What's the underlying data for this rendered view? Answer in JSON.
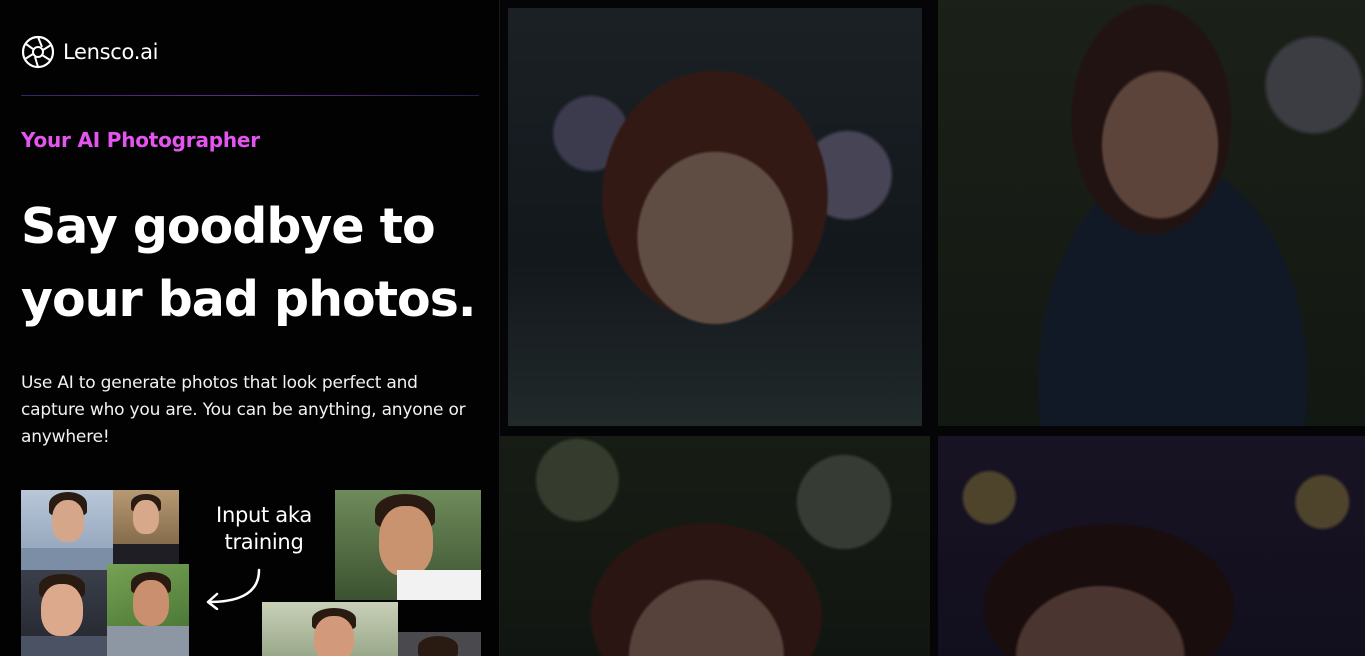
{
  "brand": {
    "name": "Lensco.ai",
    "logo_icon": "aperture-icon"
  },
  "hero": {
    "tagline": "Your AI Photographer",
    "headline_line1": "Say goodbye to",
    "headline_line2": "your bad photos.",
    "description": "Use AI to generate photos that look perfect and capture who you are. You can be anything, anyone or anywhere!"
  },
  "collage": {
    "label_line1": "Input aka",
    "label_line2": "training",
    "arrow_icon": "curved-arrow-icon"
  },
  "colors": {
    "accent": "#e455f0",
    "background": "#020203"
  }
}
